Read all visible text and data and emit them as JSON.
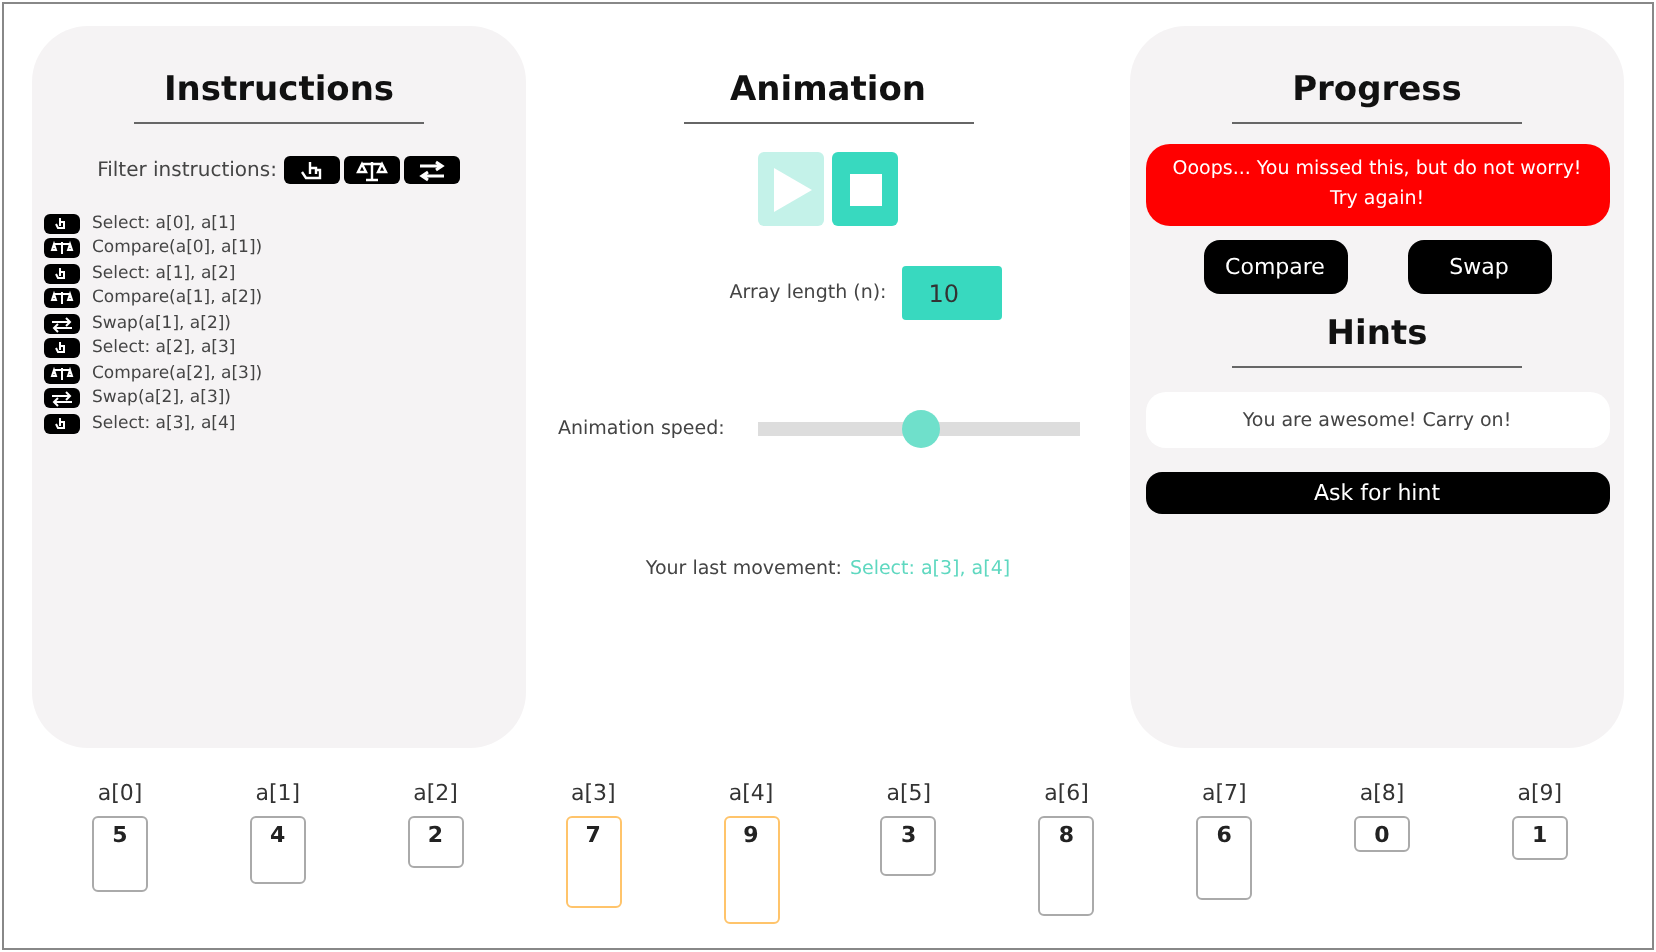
{
  "instructions": {
    "title": "Instructions",
    "filter_label": "Filter instructions:",
    "filters": [
      {
        "kind": "select"
      },
      {
        "kind": "compare"
      },
      {
        "kind": "swap"
      }
    ],
    "items": [
      {
        "kind": "select",
        "text": "Select: a[0], a[1]"
      },
      {
        "kind": "compare",
        "text": "Compare(a[0], a[1])"
      },
      {
        "kind": "select",
        "text": "Select: a[1], a[2]"
      },
      {
        "kind": "compare",
        "text": "Compare(a[1], a[2])"
      },
      {
        "kind": "swap",
        "text": "Swap(a[1], a[2])"
      },
      {
        "kind": "select",
        "text": "Select: a[2], a[3]"
      },
      {
        "kind": "compare",
        "text": "Compare(a[2], a[3])"
      },
      {
        "kind": "swap",
        "text": "Swap(a[2], a[3])"
      },
      {
        "kind": "select",
        "text": "Select: a[3], a[4]"
      }
    ]
  },
  "animation": {
    "title": "Animation",
    "play": {
      "disabled": true
    },
    "stop": {
      "disabled": false
    },
    "length_label": "Array length (n):",
    "length_value": "10",
    "speed_label": "Animation speed:",
    "speed": {
      "level": 0.5
    },
    "last_label": "Your last movement:",
    "last_value": "Select: a[3], a[4]"
  },
  "progress": {
    "title": "Progress",
    "message": "Ooops... You missed this, but do not worry! Try again!",
    "buttons": [
      "Compare",
      "Swap"
    ],
    "hints_title": "Hints",
    "hint": "You are awesome! Carry on!",
    "hint_button": "Ask for hint"
  },
  "array": [
    {
      "label": "a[0]",
      "value": "5",
      "selected": false
    },
    {
      "label": "a[1]",
      "value": "4",
      "selected": false
    },
    {
      "label": "a[2]",
      "value": "2",
      "selected": false
    },
    {
      "label": "a[3]",
      "value": "7",
      "selected": true
    },
    {
      "label": "a[4]",
      "value": "9",
      "selected": true
    },
    {
      "label": "a[5]",
      "value": "3",
      "selected": false
    },
    {
      "label": "a[6]",
      "value": "8",
      "selected": false
    },
    {
      "label": "a[7]",
      "value": "6",
      "selected": false
    },
    {
      "label": "a[8]",
      "value": "0",
      "selected": false
    },
    {
      "label": "a[9]",
      "value": "1",
      "selected": false
    }
  ]
}
